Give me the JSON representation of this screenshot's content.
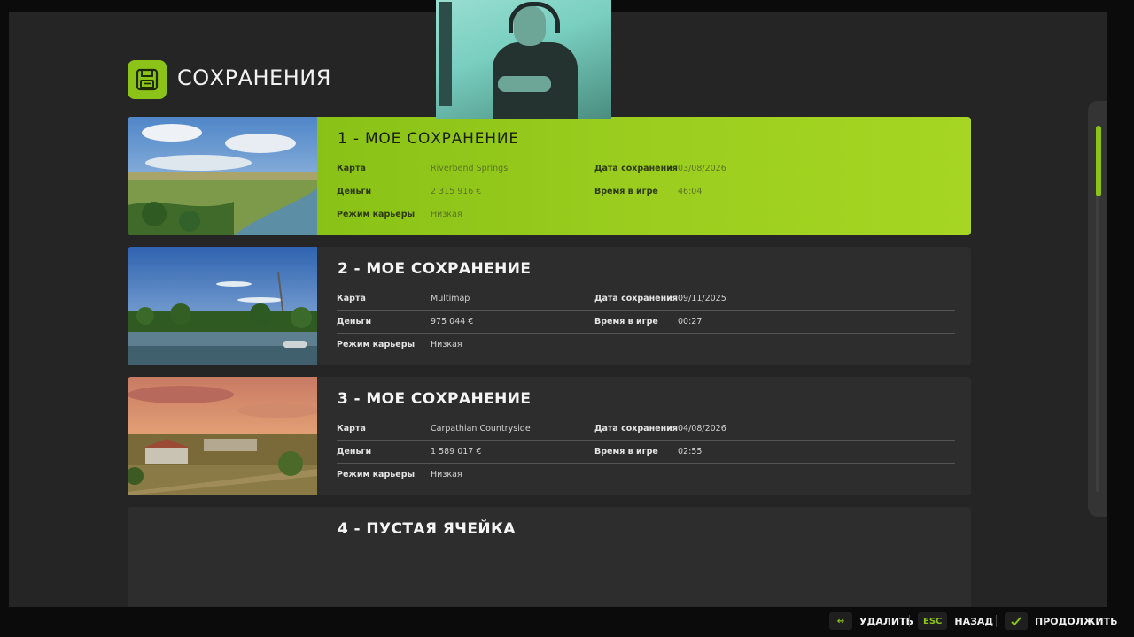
{
  "page": {
    "title": "СОХРАНЕНИЯ",
    "header_icon": "floppy-disk-icon"
  },
  "labels": {
    "map": "Карта",
    "money": "Деньги",
    "career_mode": "Режим карьеры",
    "save_date": "Дата сохранения",
    "play_time": "Время в игре"
  },
  "saves": [
    {
      "title": "1 - МОЕ СОХРАНЕНИЕ",
      "map": "Riverbend Springs",
      "money": "2 315 916 €",
      "career_mode": "Низкая",
      "save_date": "03/08/2026",
      "play_time": "46:04",
      "selected": true
    },
    {
      "title": "2 - МОЕ СОХРАНЕНИЕ",
      "map": "Multimap",
      "money": "975 044 €",
      "career_mode": "Низкая",
      "save_date": "09/11/2025",
      "play_time": "00:27",
      "selected": false
    },
    {
      "title": "3 - МОЕ СОХРАНЕНИЕ",
      "map": "Carpathian Countryside",
      "money": "1 589 017 €",
      "career_mode": "Низкая",
      "save_date": "04/08/2026",
      "play_time": "02:55",
      "selected": false
    },
    {
      "title": "4 - ПУСТАЯ ЯЧЕЙКА",
      "empty": true
    }
  ],
  "footer": {
    "delete": {
      "key_icon": "double-arrow-icon",
      "label": "УДАЛИТЬ"
    },
    "back": {
      "key": "ESC",
      "label": "НАЗАД"
    },
    "continue": {
      "key_icon": "confirm-icon",
      "label": "ПРОДОЛЖИТЬ"
    }
  },
  "colors": {
    "accent": "#8bc319",
    "selected_card": "#9acd1e",
    "card_bg": "#2d2d2d",
    "screen_bg": "#252525"
  }
}
